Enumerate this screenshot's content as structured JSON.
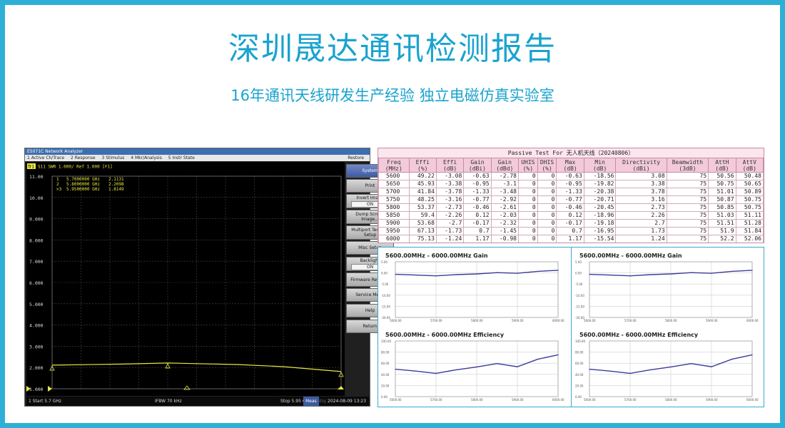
{
  "header": {
    "title": "深圳晟达通讯检测报告",
    "subtitle": "16年通讯天线研发生产经验 独立电磁仿真实验室"
  },
  "vna": {
    "window_title": "E5071C Network Analyzer",
    "menu": [
      "1 Active Ch/Trace",
      "2 Response",
      "3 Stimulus",
      "4 Mkr/Analysis",
      "5 Instr State"
    ],
    "menu_right": "Restore",
    "trace_badge": "Tr1",
    "trace_label": "S11  SWR 1.000/ Ref 1.000 [F1]",
    "markers": [
      {
        "id": "1",
        "freq": "5.7000000 GHz",
        "val": "2.1131"
      },
      {
        "id": "2",
        "freq": "5.8000000 GHz",
        "val": "2.2098"
      },
      {
        "id": ">3",
        "freq": "5.9500000 GHz",
        "val": "1.8149"
      }
    ],
    "y_ticks": [
      "11.00",
      "10.00",
      "9.000",
      "8.000",
      "7.000",
      "6.000",
      "5.000",
      "4.000",
      "3.000",
      "2.000",
      "1.000"
    ],
    "y_range": [
      1,
      11
    ],
    "freq_range_ghz": [
      5.7,
      5.95
    ],
    "trace_points": [
      [
        5.7,
        2.11
      ],
      [
        5.76,
        2.16
      ],
      [
        5.8,
        2.21
      ],
      [
        5.86,
        2.14
      ],
      [
        5.9,
        2.04
      ],
      [
        5.95,
        1.81
      ]
    ],
    "trace_color": "#e7e640",
    "softkeys": [
      {
        "label": "System",
        "active": true
      },
      {
        "label": "Print"
      },
      {
        "label": "Invert Image",
        "value": "ON"
      },
      {
        "label": "Dump Screen Image..."
      },
      {
        "label": "Multiport Test Set Setup"
      },
      {
        "label": "Misc Setup"
      },
      {
        "label": "Backlight",
        "value": "ON"
      },
      {
        "label": "Firmware Revision"
      },
      {
        "label": "Service Menu"
      },
      {
        "label": "Help"
      },
      {
        "label": "Return"
      }
    ],
    "status": {
      "start": "1  Start 5.7 GHz",
      "ifbw": "IFBW 70 kHz",
      "stop": "Stop 5.95 GHz",
      "mode": "Meas",
      "flags": "Stop ExtRef Svc",
      "datetime": "2024-08-09 13:23"
    }
  },
  "passive_table": {
    "title": "Passive Test For 无人机天线（20240806）",
    "headers": [
      [
        "Freq",
        "(MHz)"
      ],
      [
        "Effi",
        "(%)"
      ],
      [
        "Effi",
        "(dB)"
      ],
      [
        "Gain",
        "(dBi)"
      ],
      [
        "Gain",
        "(dBd)"
      ],
      [
        "UHIS",
        "(%)"
      ],
      [
        "DHIS",
        "(%)"
      ],
      [
        "Max",
        "(dB)"
      ],
      [
        "Min",
        "(dB)"
      ],
      [
        "Directivity",
        "(dBi)"
      ],
      [
        "Beamwidth",
        "(3dB)"
      ],
      [
        "AttH",
        "(dB)"
      ],
      [
        "AttV",
        "(dB)"
      ]
    ],
    "rows": [
      [
        "5600",
        "49.22",
        "-3.08",
        "-0.63",
        "-2.78",
        "0",
        "0",
        "-0.63",
        "-18.56",
        "3.08",
        "75",
        "50.56",
        "50.48"
      ],
      [
        "5650",
        "45.93",
        "-3.38",
        "-0.95",
        "-3.1",
        "0",
        "0",
        "-0.95",
        "-19.82",
        "3.38",
        "75",
        "50.75",
        "50.65"
      ],
      [
        "5700",
        "41.84",
        "-3.78",
        "-1.33",
        "-3.48",
        "0",
        "0",
        "-1.33",
        "-20.38",
        "3.78",
        "75",
        "51.01",
        "50.89"
      ],
      [
        "5750",
        "48.25",
        "-3.16",
        "-0.77",
        "-2.92",
        "0",
        "0",
        "-0.77",
        "-20.71",
        "3.16",
        "75",
        "50.87",
        "50.75"
      ],
      [
        "5800",
        "53.37",
        "-2.73",
        "-0.46",
        "-2.61",
        "0",
        "0",
        "-0.46",
        "-20.45",
        "2.73",
        "75",
        "50.85",
        "50.75"
      ],
      [
        "5850",
        "59.4",
        "-2.26",
        "0.12",
        "-2.03",
        "0",
        "0",
        "0.12",
        "-18.96",
        "2.26",
        "75",
        "51.03",
        "51.11"
      ],
      [
        "5900",
        "53.68",
        "-2.7",
        "-0.17",
        "-2.32",
        "0",
        "0",
        "-0.17",
        "-19.18",
        "2.7",
        "75",
        "51.51",
        "51.28"
      ],
      [
        "5950",
        "67.13",
        "-1.73",
        "0.7",
        "-1.45",
        "0",
        "0",
        "0.7",
        "-16.95",
        "1.73",
        "75",
        "51.9",
        "51.84"
      ],
      [
        "6000",
        "75.13",
        "-1.24",
        "1.17",
        "-0.98",
        "0",
        "0",
        "1.17",
        "-15.54",
        "1.24",
        "75",
        "52.2",
        "52.06"
      ]
    ]
  },
  "chart_data": [
    {
      "type": "line",
      "title": "5600.00MHz - 6000.00MHz Gain",
      "x": [
        5600,
        5650,
        5700,
        5750,
        5800,
        5850,
        5900,
        5950,
        6000
      ],
      "series": [
        {
          "values": [
            -0.63,
            -0.95,
            -1.33,
            -0.77,
            -0.46,
            0.12,
            -0.17,
            0.7,
            1.17
          ]
        }
      ],
      "yticks": [
        "5.00",
        "0.00",
        "-5.00",
        "-10.00",
        "-15.00",
        "-20.00"
      ],
      "ylim": [
        -20,
        5
      ],
      "xticks": [
        "5600.00",
        "5700.00",
        "5800.00",
        "5900.00",
        "6000.00"
      ],
      "xlim": [
        5600,
        6000
      ],
      "grid": true,
      "line_color": "#3b3a9c"
    },
    {
      "type": "line",
      "title": "5600.00MHz - 6000.00MHz Gain",
      "x": [
        5600,
        5650,
        5700,
        5750,
        5800,
        5850,
        5900,
        5950,
        6000
      ],
      "series": [
        {
          "values": [
            -0.63,
            -0.95,
            -1.33,
            -0.77,
            -0.46,
            0.12,
            -0.17,
            0.7,
            1.17
          ]
        }
      ],
      "yticks": [
        "5.00",
        "0.00",
        "-5.00",
        "-10.00",
        "-15.00",
        "-20.00"
      ],
      "ylim": [
        -20,
        5
      ],
      "xticks": [
        "5600.00",
        "5700.00",
        "5800.00",
        "5900.00",
        "6000.00"
      ],
      "xlim": [
        5600,
        6000
      ],
      "grid": true,
      "line_color": "#3b3a9c"
    },
    {
      "type": "line",
      "title": "5600.00MHz - 6000.00MHz Efficiency",
      "x": [
        5600,
        5650,
        5700,
        5750,
        5800,
        5850,
        5900,
        5950,
        6000
      ],
      "series": [
        {
          "values": [
            49.22,
            45.93,
            41.84,
            48.25,
            53.37,
            59.4,
            53.68,
            67.13,
            75.13
          ]
        }
      ],
      "yticks": [
        "100.00",
        "80.00",
        "60.00",
        "40.00",
        "20.00",
        "0.00"
      ],
      "ylim": [
        0,
        100
      ],
      "xticks": [
        "5600.00",
        "5700.00",
        "5800.00",
        "5900.00",
        "6000.00"
      ],
      "xlim": [
        5600,
        6000
      ],
      "grid": true,
      "line_color": "#3b3a9c"
    },
    {
      "type": "line",
      "title": "5600.00MHz - 6000.00MHz Efficiency",
      "x": [
        5600,
        5650,
        5700,
        5750,
        5800,
        5850,
        5900,
        5950,
        6000
      ],
      "series": [
        {
          "values": [
            49.22,
            45.93,
            41.84,
            48.25,
            53.37,
            59.4,
            53.68,
            67.13,
            75.13
          ]
        }
      ],
      "yticks": [
        "100.00",
        "80.00",
        "60.00",
        "40.00",
        "20.00",
        "0.00"
      ],
      "ylim": [
        0,
        100
      ],
      "xticks": [
        "5600.00",
        "5700.00",
        "5800.00",
        "5900.00",
        "6000.00"
      ],
      "xlim": [
        5600,
        6000
      ],
      "grid": true,
      "line_color": "#3b3a9c"
    }
  ]
}
